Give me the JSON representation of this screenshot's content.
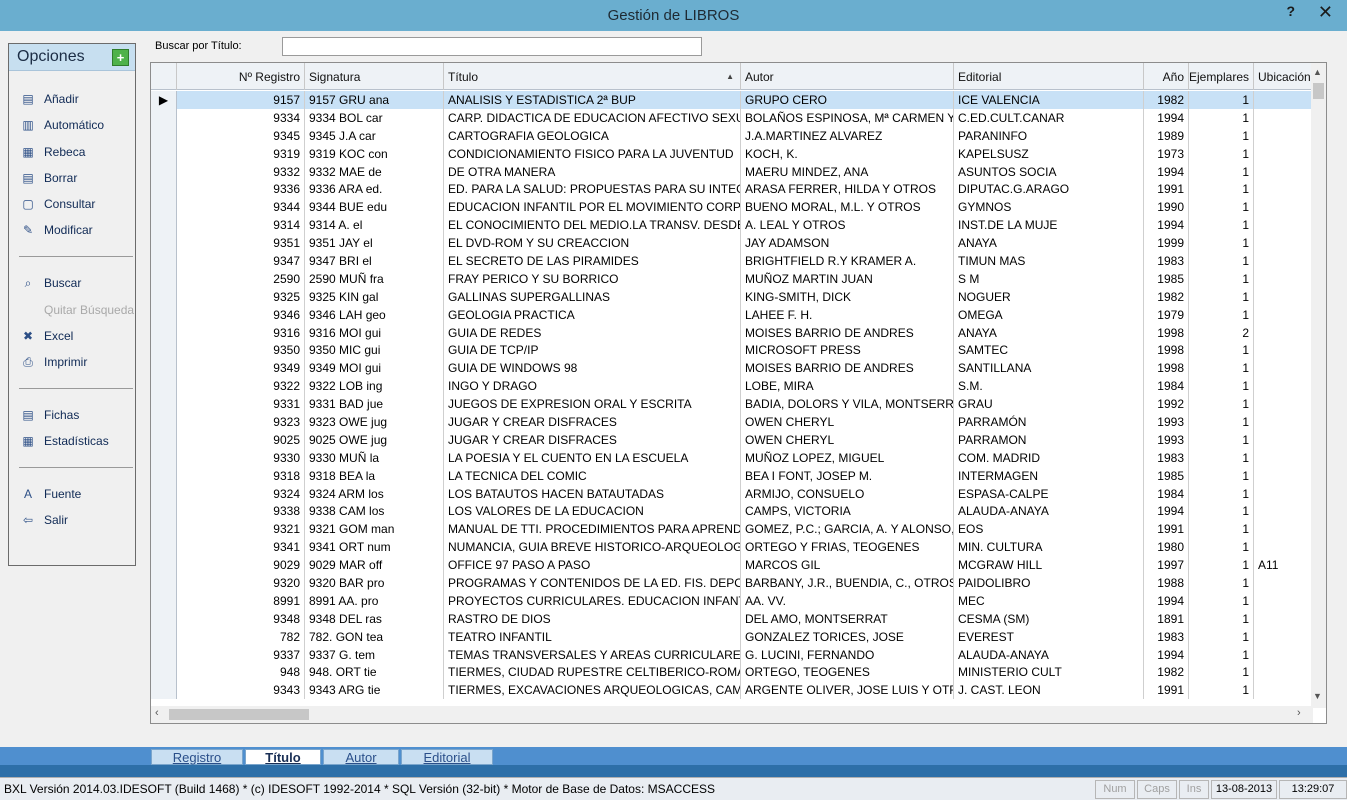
{
  "window": {
    "title": "Gestión de LIBROS",
    "help": "?",
    "close": "✕"
  },
  "sidebar": {
    "title": "Opciones",
    "add_icon": "+",
    "items": [
      {
        "label": "Añadir",
        "icon": "add-book-icon",
        "glyph": "▤"
      },
      {
        "label": "Automático",
        "icon": "barcode-icon",
        "glyph": "▥"
      },
      {
        "label": "Rebeca",
        "icon": "database-icon",
        "glyph": "▦"
      },
      {
        "label": "Borrar",
        "icon": "delete-icon",
        "glyph": "▤"
      },
      {
        "label": "Consultar",
        "icon": "view-icon",
        "glyph": "▢"
      },
      {
        "label": "Modificar",
        "icon": "edit-icon",
        "glyph": "✎"
      },
      {
        "label": "Buscar",
        "icon": "search-icon",
        "glyph": "⌕"
      },
      {
        "label": "Quitar Búsqueda",
        "icon": "",
        "glyph": "",
        "disabled": true
      },
      {
        "label": "Excel",
        "icon": "excel-icon",
        "glyph": "✖"
      },
      {
        "label": "Imprimir",
        "icon": "printer-icon",
        "glyph": "⎙"
      },
      {
        "label": "Fichas",
        "icon": "cards-icon",
        "glyph": "▤"
      },
      {
        "label": "Estadísticas",
        "icon": "stats-icon",
        "glyph": "▦"
      },
      {
        "label": "Fuente",
        "icon": "font-icon",
        "glyph": "A"
      },
      {
        "label": "Salir",
        "icon": "exit-icon",
        "glyph": "⇦"
      }
    ]
  },
  "search": {
    "label": "Buscar por Título:",
    "value": ""
  },
  "grid": {
    "columns": [
      "Nº Registro",
      "Signatura",
      "Título",
      "Autor",
      "Editorial",
      "Año",
      "Ejemplares",
      "Ubicación"
    ],
    "sorted_indicator": "▲",
    "rows": [
      [
        "9157",
        "9157 GRU ana",
        "ANALISIS Y ESTADISTICA 2ª BUP",
        "GRUPO CERO",
        "ICE VALENCIA",
        "1982",
        "1",
        ""
      ],
      [
        "9334",
        "9334 BOL car",
        "CARP. DIDACTICA DE EDUCACION AFECTIVO SEXUAL",
        "BOLAÑOS ESPINOSA, Mª CARMEN Y C",
        "C.ED.CULT.CANAR",
        "1994",
        "1",
        ""
      ],
      [
        "9345",
        "9345 J.A car",
        "CARTOGRAFIA GEOLOGICA",
        "J.A.MARTINEZ ALVAREZ",
        "PARANINFO",
        "1989",
        "1",
        ""
      ],
      [
        "9319",
        "9319 KOC con",
        "CONDICIONAMIENTO FISICO PARA LA JUVENTUD",
        "KOCH, K.",
        "KAPELSUSZ",
        "1973",
        "1",
        ""
      ],
      [
        "9332",
        "9332 MAE de",
        "DE OTRA MANERA",
        "MAERU MINDEZ, ANA",
        "ASUNTOS SOCIA",
        "1994",
        "1",
        ""
      ],
      [
        "9336",
        "9336 ARA ed.",
        "ED. PARA LA SALUD: PROPUESTAS PARA SU INTEG.",
        "ARASA FERRER, HILDA Y OTROS",
        "DIPUTAC.G.ARAGO",
        "1991",
        "1",
        ""
      ],
      [
        "9344",
        "9344 BUE edu",
        "EDUCACION INFANTIL POR EL MOVIMIENTO CORPORAL",
        "BUENO MORAL, M.L. Y OTROS",
        "GYMNOS",
        "1990",
        "1",
        ""
      ],
      [
        "9314",
        "9314 A. el",
        "EL CONOCIMIENTO DEL MEDIO.LA TRANSV. DESDE LA",
        "A. LEAL Y OTROS",
        "INST.DE LA MUJE",
        "1994",
        "1",
        ""
      ],
      [
        "9351",
        "9351 JAY el",
        "EL DVD-ROM Y SU CREACCION",
        "JAY ADAMSON",
        "ANAYA",
        "1999",
        "1",
        ""
      ],
      [
        "9347",
        "9347 BRI el",
        "EL SECRETO DE LAS PIRAMIDES",
        "BRIGHTFIELD R.Y KRAMER A.",
        "TIMUN MAS",
        "1983",
        "1",
        ""
      ],
      [
        "2590",
        "2590 MUÑ fra",
        "FRAY PERICO Y SU BORRICO",
        "MUÑOZ MARTIN JUAN",
        "S M",
        "1985",
        "1",
        ""
      ],
      [
        "9325",
        "9325 KIN gal",
        "GALLINAS SUPERGALLINAS",
        "KING-SMITH, DICK",
        "NOGUER",
        "1982",
        "1",
        ""
      ],
      [
        "9346",
        "9346 LAH geo",
        "GEOLOGIA PRACTICA",
        "LAHEE F. H.",
        "OMEGA",
        "1979",
        "1",
        ""
      ],
      [
        "9316",
        "9316 MOI gui",
        "GUIA DE REDES",
        "MOISES BARRIO DE ANDRES",
        "ANAYA",
        "1998",
        "2",
        ""
      ],
      [
        "9350",
        "9350 MIC gui",
        "GUIA DE TCP/IP",
        "MICROSOFT PRESS",
        "SAMTEC",
        "1998",
        "1",
        ""
      ],
      [
        "9349",
        "9349 MOI gui",
        "GUIA DE WINDOWS 98",
        "MOISES BARRIO DE ANDRES",
        "SANTILLANA",
        "1998",
        "1",
        ""
      ],
      [
        "9322",
        "9322 LOB ing",
        "INGO Y DRAGO",
        "LOBE, MIRA",
        "S.M.",
        "1984",
        "1",
        ""
      ],
      [
        "9331",
        "9331 BAD jue",
        "JUEGOS DE EXPRESION ORAL Y ESCRITA",
        "BADIA, DOLORS Y VILA, MONTSERRAT",
        "GRAU",
        "1992",
        "1",
        ""
      ],
      [
        "9323",
        "9323 OWE jug",
        "JUGAR Y CREAR DISFRACES",
        "OWEN CHERYL",
        "PARRAMÓN",
        "1993",
        "1",
        ""
      ],
      [
        "9025",
        "9025 OWE jug",
        "JUGAR Y CREAR DISFRACES",
        "OWEN CHERYL",
        "PARRAMON",
        "1993",
        "1",
        ""
      ],
      [
        "9330",
        "9330 MUÑ la",
        "LA POESIA Y EL CUENTO EN LA ESCUELA",
        "MUÑOZ LOPEZ, MIGUEL",
        "COM. MADRID",
        "1983",
        "1",
        ""
      ],
      [
        "9318",
        "9318 BEA la",
        "LA TECNICA DEL COMIC",
        "BEA I FONT, JOSEP M.",
        "INTERMAGEN",
        "1985",
        "1",
        ""
      ],
      [
        "9324",
        "9324 ARM los",
        "LOS BATAUTOS HACEN BATAUTADAS",
        "ARMIJO, CONSUELO",
        "ESPASA-CALPE",
        "1984",
        "1",
        ""
      ],
      [
        "9338",
        "9338 CAM los",
        "LOS VALORES DE LA EDUCACION",
        "CAMPS, VICTORIA",
        "ALAUDA-ANAYA",
        "1994",
        "1",
        ""
      ],
      [
        "9321",
        "9321 GOM man",
        "MANUAL DE TTI. PROCEDIMIENTOS PARA APRENDER",
        "GOMEZ, P.C.; GARCIA, A. Y ALONSO, F",
        "EOS",
        "1991",
        "1",
        ""
      ],
      [
        "9341",
        "9341 ORT num",
        "NUMANCIA, GUIA BREVE HISTORICO-ARQUEOLOGICA",
        "ORTEGO Y FRIAS, TEOGENES",
        "MIN. CULTURA",
        "1980",
        "1",
        ""
      ],
      [
        "9029",
        "9029 MAR off",
        "OFFICE 97 PASO A PASO",
        "MARCOS GIL",
        "MCGRAW HILL",
        "1997",
        "1",
        "A11"
      ],
      [
        "9320",
        "9320 BAR pro",
        "PROGRAMAS Y CONTENIDOS DE LA ED. FIS. DEPORTIVA",
        "BARBANY, J.R., BUENDIA, C., OTROS",
        "PAIDOLIBRO",
        "1988",
        "1",
        ""
      ],
      [
        "8991",
        "8991 AA. pro",
        "PROYECTOS CURRICULARES. EDUCACION INFANTIL",
        "AA. VV.",
        "MEC",
        "1994",
        "1",
        ""
      ],
      [
        "9348",
        "9348 DEL ras",
        "RASTRO DE DIOS",
        "DEL AMO, MONTSERRAT",
        "CESMA (SM)",
        "1891",
        "1",
        ""
      ],
      [
        "782",
        "782. GON tea",
        "TEATRO INFANTIL",
        "GONZALEZ TORICES, JOSE",
        "EVEREST",
        "1983",
        "1",
        ""
      ],
      [
        "9337",
        "9337 G. tem",
        "TEMAS TRANSVERSALES Y AREAS CURRICULARES",
        "G. LUCINI, FERNANDO",
        "ALAUDA-ANAYA",
        "1994",
        "1",
        ""
      ],
      [
        "948",
        "948. ORT tie",
        "TIERMES, CIUDAD RUPESTRE CELTIBERICO-ROMANA",
        "ORTEGO, TEOGENES",
        "MINISTERIO CULT",
        "1982",
        "1",
        ""
      ],
      [
        "9343",
        "9343 ARG tie",
        "TIERMES, EXCAVACIONES ARQUEOLOGICAS, CAMPAÑA",
        "ARGENTE OLIVER, JOSE LUIS Y OTROS",
        "J. CAST. LEON",
        "1991",
        "1",
        ""
      ]
    ]
  },
  "tabs": [
    "Registro",
    "Título",
    "Autor",
    "Editorial"
  ],
  "status": {
    "main": "BXL Versión 2014.03.IDESOFT  (Build 1468) * (c) IDESOFT 1992-2014 *  SQL Versión (32-bit) * Motor de Base de Datos: MSACCESS",
    "num": "Num",
    "caps": "Caps",
    "ins": "Ins",
    "date": "13-08-2013",
    "time": "13:29:07"
  }
}
